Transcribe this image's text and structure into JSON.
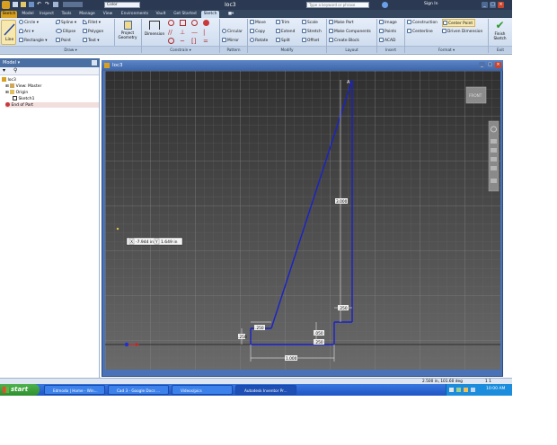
{
  "app": {
    "title": "Ioc3",
    "search_placeholder": "Type a keyword or phrase",
    "sign_in": "Sign In",
    "appearance_value": "Color"
  },
  "tabs": [
    "Sketch",
    "Model",
    "Inspect",
    "Tools",
    "Manage",
    "View",
    "Environments",
    "Vault",
    "Get Started",
    "Sketch"
  ],
  "ribbon": {
    "line": "Line",
    "circle": "Circle",
    "arc": "Arc",
    "rectangle": "Rectangle",
    "spline": "Spline",
    "ellipse": "Ellipse",
    "point": "Point",
    "fillet": "Fillet",
    "polygon": "Polygon",
    "text": "Text",
    "project_geometry": "Project Geometry",
    "dimension": "Dimension",
    "circular": "Circular",
    "mirror": "Mirror",
    "move": "Move",
    "copy": "Copy",
    "rotate": "Rotate",
    "trim": "Trim",
    "extend": "Extend",
    "split": "Split",
    "scale": "Scale",
    "stretch": "Stretch",
    "offset": "Offset",
    "make_part": "Make Part",
    "make_components": "Make Components",
    "create_block": "Create Block",
    "image": "Image",
    "points": "Points",
    "acad": "ACAD",
    "construction": "Construction",
    "centerline": "Centerline",
    "center_point": "Center Point",
    "driven_dimension": "Driven Dimension",
    "finish_sketch": "Finish Sketch",
    "groups": [
      "Draw ▾",
      "Constrain ▾",
      "Pattern",
      "Modify",
      "Layout",
      "Insert",
      "Format ▾",
      "Exit"
    ]
  },
  "browser": {
    "header": "Model ▾",
    "items": [
      "Ioc3",
      "View: Master",
      "Origin",
      "Sketch1",
      "End of Part"
    ]
  },
  "document": {
    "title": "Ioc3",
    "input_x": "-7.944 in",
    "input_y": "1.649 in",
    "dim_vertical": "3.000",
    "dim_step_w": ".250",
    "dim_small_w": ".250",
    "dim_small_h": ".050",
    "dim_offset": ".250",
    "dim_base": "1.000",
    "dim_step_h": ".250",
    "viewcube_label": "FRONT"
  },
  "statusbar": {
    "coords": "2.500 in, 101.60 deg",
    "counts": "1   1"
  },
  "taskbar": {
    "start": "start",
    "items": [
      "Edmodo | Home - Win...",
      "Cad 3 - Google Docs ...",
      "Videos/pics",
      "Autodesk Inventor Pr..."
    ],
    "clock": "10:00 AM"
  },
  "colors": {
    "sketch_line": "#1a22c8",
    "canvas_bg": "#4d4d4d",
    "ribbon_bg": "#d4e1f1"
  }
}
